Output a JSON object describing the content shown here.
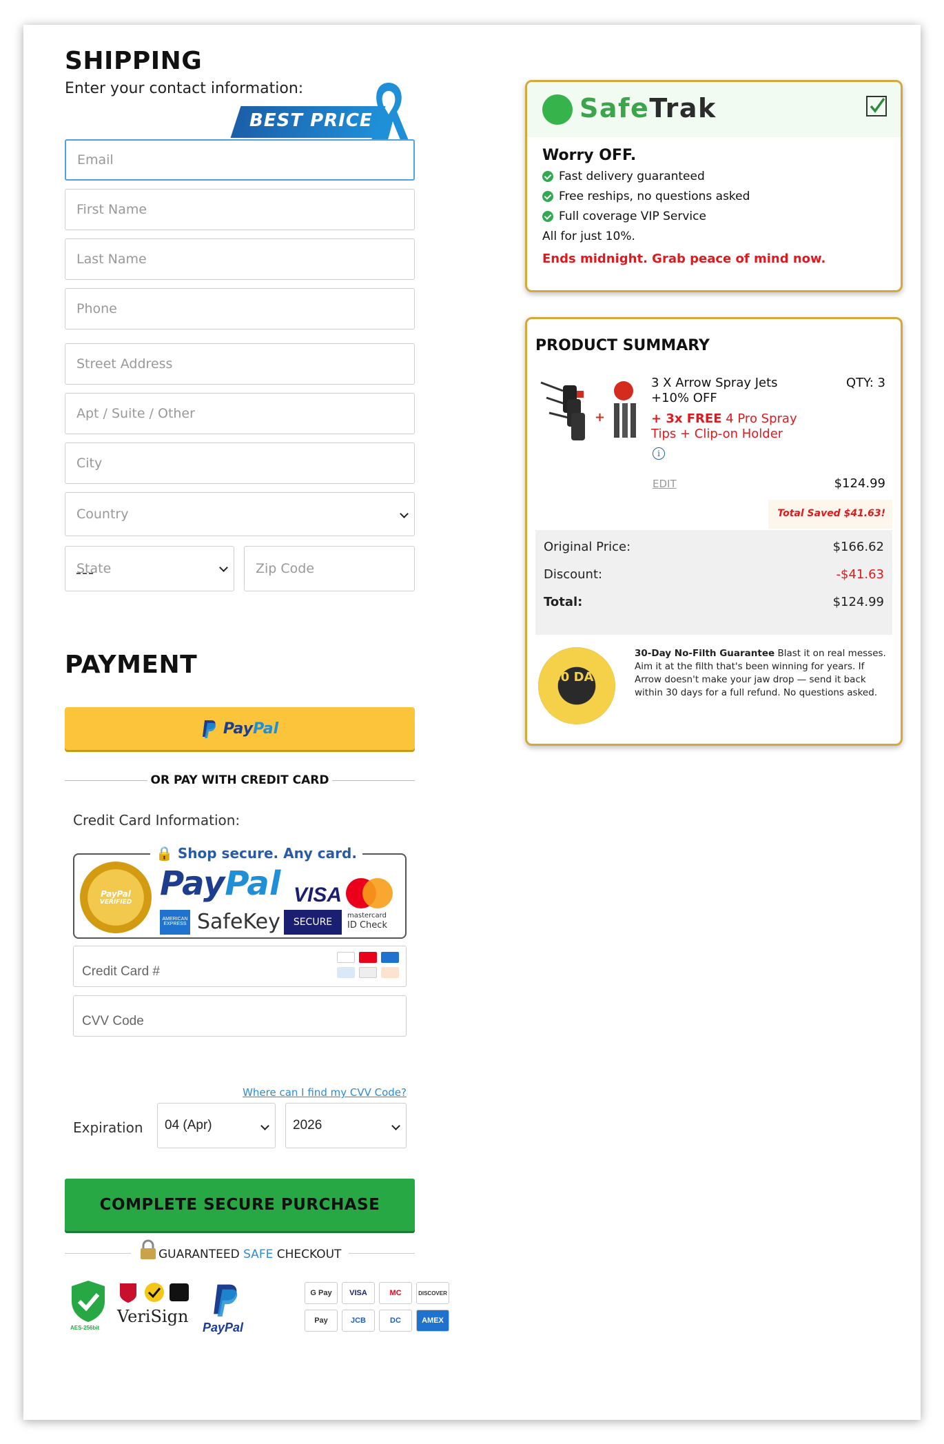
{
  "shipping": {
    "title": "SHIPPING",
    "subtitle": "Enter your contact information:",
    "badge": "BEST PRICE",
    "fields": {
      "email": "Email",
      "first_name": "First Name",
      "last_name": "Last Name",
      "phone": "Phone",
      "street": "Street Address",
      "apt": "Apt / Suite / Other",
      "city": "City",
      "country": "Country",
      "state": "State",
      "zip": "Zip Code"
    }
  },
  "payment": {
    "title": "PAYMENT",
    "paypal_label_a": "Pay",
    "paypal_label_b": "Pal",
    "or_text": "OR PAY WITH CREDIT CARD",
    "cc_info_label": "Credit Card Information:",
    "secure_heading": "Shop secure. Any card.",
    "seal_text_a": "PayPal",
    "seal_text_b": "VERIFIED",
    "brand_paypal_a": "Pay",
    "brand_paypal_b": "Pal",
    "brand_visa": "VISA",
    "brand_amex": "AMERICAN EXPRESS",
    "brand_safekey": "SafeKey",
    "brand_visa_secure": "SECURE",
    "brand_mc_a": "mastercard",
    "brand_mc_b": "ID Check",
    "card_number_placeholder": "Credit Card #",
    "cvv_placeholder": "CVV Code",
    "cvv_link": "Where can I find my CVV Code?",
    "expiration_label": "Expiration",
    "exp_month": "04 (Apr)",
    "exp_year": "2026",
    "submit_label": "COMPLETE SECURE PURCHASE",
    "guaranteed_a": "GUARANTEED ",
    "guaranteed_b": "SAFE",
    "guaranteed_c": " CHECKOUT",
    "trust_badges": {
      "aes": "AES-256bit",
      "verisign": "VeriSign",
      "paypal": "PayPal",
      "cards": [
        "G Pay",
        "VISA",
        "MC",
        "DISCOVER",
        "Pay",
        "JCB",
        "DC",
        "AMEX"
      ]
    }
  },
  "safetrak": {
    "brand_a": "Safe",
    "brand_b": "Trak",
    "title": "Worry OFF.",
    "bullets": [
      "Fast delivery guaranteed",
      "Free reships, no questions asked",
      "Full coverage VIP Service"
    ],
    "price_note": "All for just 10%.",
    "urgency": "Ends midnight. Grab peace of mind now."
  },
  "summary": {
    "title": "PRODUCT SUMMARY",
    "product_name": "3 X Arrow Spray Jets +10% OFF",
    "free_bold": "+ 3x FREE",
    "free_rest": " 4 Pro Spray Tips + Clip-on Holder",
    "qty": "QTY: 3",
    "edit": "EDIT",
    "item_price": "$124.99",
    "total_saved": "Total Saved $41.63!",
    "original_label": "Original Price:",
    "original_value": "$166.62",
    "discount_label": "Discount:",
    "discount_value": "-$41.63",
    "total_label": "Total:",
    "total_value": "$124.99",
    "seal_text": "30 DAY",
    "guarantee_bold": "30-Day No-Filth Guarantee",
    "guarantee_text": " Blast it on real messes. Aim it at the filth that's been winning for years. If Arrow doesn't make your jaw drop — send it back within 30 days for a full refund. No questions asked."
  }
}
